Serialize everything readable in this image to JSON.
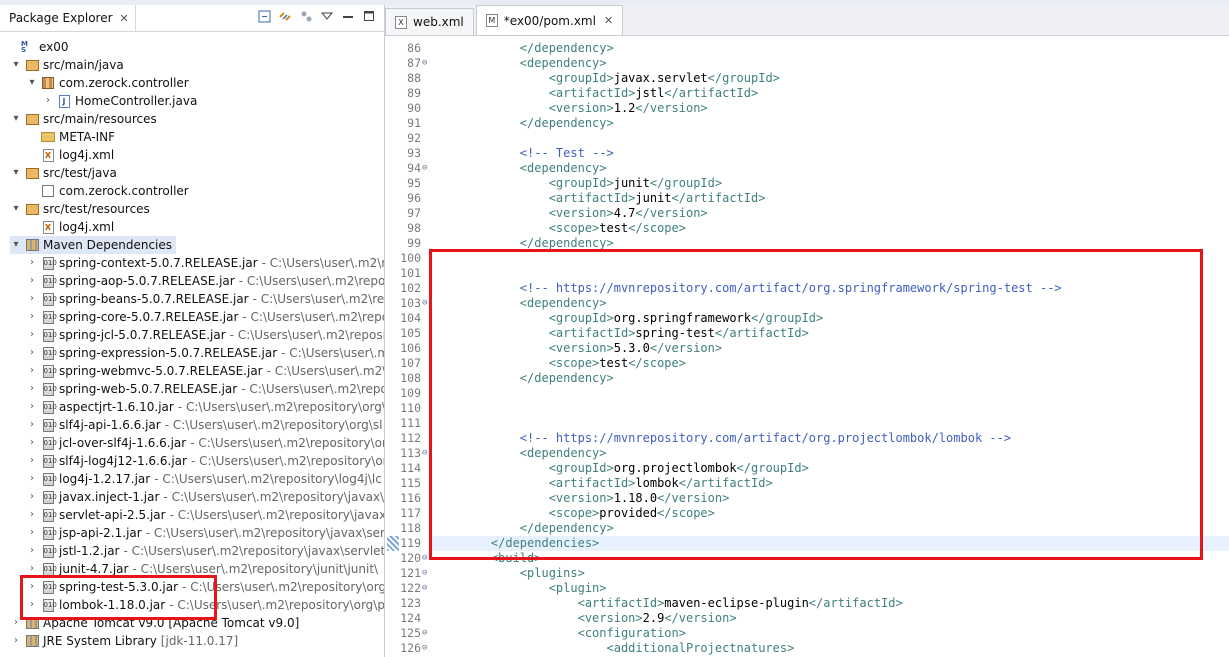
{
  "left_panel": {
    "title": "Package Explorer",
    "close": "✕",
    "tree": [
      {
        "label": "ex00",
        "path": "",
        "icon": "project-icon",
        "twisty": "",
        "indent": 0
      },
      {
        "label": "src/main/java",
        "path": "",
        "icon": "package-folder-icon",
        "twisty": "▾",
        "indent": 1
      },
      {
        "label": "com.zerock.controller",
        "path": "",
        "icon": "package-icon",
        "twisty": "▾",
        "indent": 2
      },
      {
        "label": "HomeController.java",
        "path": "",
        "icon": "java-file-icon",
        "twisty": "›",
        "indent": 3
      },
      {
        "label": "src/main/resources",
        "path": "",
        "icon": "package-folder-icon",
        "twisty": "▾",
        "indent": 1
      },
      {
        "label": "META-INF",
        "path": "",
        "icon": "folder-icon",
        "twisty": "",
        "indent": 2
      },
      {
        "label": "log4j.xml",
        "path": "",
        "icon": "xml-file-icon",
        "twisty": "",
        "indent": 2
      },
      {
        "label": "src/test/java",
        "path": "",
        "icon": "package-folder-icon",
        "twisty": "▾",
        "indent": 1
      },
      {
        "label": "com.zerock.controller",
        "path": "",
        "icon": "empty-package-icon",
        "twisty": "",
        "indent": 2
      },
      {
        "label": "src/test/resources",
        "path": "",
        "icon": "package-folder-icon",
        "twisty": "▾",
        "indent": 1
      },
      {
        "label": "log4j.xml",
        "path": "",
        "icon": "xml-file-icon",
        "twisty": "",
        "indent": 2
      },
      {
        "label": "Maven Dependencies",
        "path": "",
        "icon": "library-icon",
        "twisty": "▾",
        "indent": 1,
        "selected": true
      },
      {
        "label": "spring-context-5.0.7.RELEASE.jar",
        "path": "- C:\\Users\\user\\.m2\\rep",
        "icon": "jar-icon",
        "twisty": "›",
        "indent": 2
      },
      {
        "label": "spring-aop-5.0.7.RELEASE.jar",
        "path": "- C:\\Users\\user\\.m2\\repositor",
        "icon": "jar-icon",
        "twisty": "›",
        "indent": 2
      },
      {
        "label": "spring-beans-5.0.7.RELEASE.jar",
        "path": "- C:\\Users\\user\\.m2\\repo",
        "icon": "jar-icon",
        "twisty": "›",
        "indent": 2
      },
      {
        "label": "spring-core-5.0.7.RELEASE.jar",
        "path": "- C:\\Users\\user\\.m2\\reposi",
        "icon": "jar-icon",
        "twisty": "›",
        "indent": 2
      },
      {
        "label": "spring-jcl-5.0.7.RELEASE.jar",
        "path": "- C:\\Users\\user\\.m2\\reposito",
        "icon": "jar-icon",
        "twisty": "›",
        "indent": 2
      },
      {
        "label": "spring-expression-5.0.7.RELEASE.jar",
        "path": "- C:\\Users\\user\\.m2\\",
        "icon": "jar-icon",
        "twisty": "›",
        "indent": 2
      },
      {
        "label": "spring-webmvc-5.0.7.RELEASE.jar",
        "path": "- C:\\Users\\user\\.m2\\re",
        "icon": "jar-icon",
        "twisty": "›",
        "indent": 2
      },
      {
        "label": "spring-web-5.0.7.RELEASE.jar",
        "path": "- C:\\Users\\user\\.m2\\repos",
        "icon": "jar-icon",
        "twisty": "›",
        "indent": 2
      },
      {
        "label": "aspectjrt-1.6.10.jar",
        "path": "- C:\\Users\\user\\.m2\\repository\\org\\",
        "icon": "jar-icon",
        "twisty": "›",
        "indent": 2
      },
      {
        "label": "slf4j-api-1.6.6.jar",
        "path": "- C:\\Users\\user\\.m2\\repository\\org\\sl",
        "icon": "jar-icon",
        "twisty": "›",
        "indent": 2
      },
      {
        "label": "jcl-over-slf4j-1.6.6.jar",
        "path": "- C:\\Users\\user\\.m2\\repository\\or",
        "icon": "jar-icon",
        "twisty": "›",
        "indent": 2
      },
      {
        "label": "slf4j-log4j12-1.6.6.jar",
        "path": "- C:\\Users\\user\\.m2\\repository\\or",
        "icon": "jar-icon",
        "twisty": "›",
        "indent": 2
      },
      {
        "label": "log4j-1.2.17.jar",
        "path": "- C:\\Users\\user\\.m2\\repository\\log4j\\lc",
        "icon": "jar-icon",
        "twisty": "›",
        "indent": 2
      },
      {
        "label": "javax.inject-1.jar",
        "path": "- C:\\Users\\user\\.m2\\repository\\javax\\i",
        "icon": "jar-icon",
        "twisty": "›",
        "indent": 2
      },
      {
        "label": "servlet-api-2.5.jar",
        "path": "- C:\\Users\\user\\.m2\\repository\\javax\\",
        "icon": "jar-icon",
        "twisty": "›",
        "indent": 2
      },
      {
        "label": "jsp-api-2.1.jar",
        "path": "- C:\\Users\\user\\.m2\\repository\\javax\\ser",
        "icon": "jar-icon",
        "twisty": "›",
        "indent": 2
      },
      {
        "label": "jstl-1.2.jar",
        "path": "- C:\\Users\\user\\.m2\\repository\\javax\\servlet\\",
        "icon": "jar-icon",
        "twisty": "›",
        "indent": 2
      },
      {
        "label": "junit-4.7.jar",
        "path": "- C:\\Users\\user\\.m2\\repository\\junit\\junit\\",
        "icon": "jar-icon",
        "twisty": "›",
        "indent": 2
      },
      {
        "label": "spring-test-5.3.0.jar",
        "path": "- C:\\Users\\user\\.m2\\repository\\org\\",
        "icon": "jar-icon",
        "twisty": "›",
        "indent": 2
      },
      {
        "label": "lombok-1.18.0.jar",
        "path": "- C:\\Users\\user\\.m2\\repository\\org\\p",
        "icon": "jar-icon",
        "twisty": "›",
        "indent": 2
      },
      {
        "label": "Apache Tomcat v9.0 [Apache Tomcat v9.0]",
        "path": "",
        "icon": "library-icon",
        "twisty": "›",
        "indent": 1
      },
      {
        "label": "JRE System Library",
        "path": "[jdk-11.0.17]",
        "icon": "library-icon",
        "twisty": "›",
        "indent": 1
      }
    ]
  },
  "editor": {
    "tabs": [
      {
        "label": "web.xml",
        "icon": "X",
        "active": false,
        "close": ""
      },
      {
        "label": "*ex00/pom.xml",
        "icon": "M",
        "active": true,
        "close": "✕"
      }
    ],
    "lines": [
      {
        "n": "86",
        "fold": "",
        "t": [
          [
            "tg",
            "        </dependency>"
          ]
        ]
      },
      {
        "n": "87",
        "fold": "⊖",
        "t": [
          [
            "tg",
            "        <dependency>"
          ]
        ]
      },
      {
        "n": "88",
        "fold": "",
        "t": [
          [
            "tg",
            "            <groupId>"
          ],
          [
            "tx",
            "javax.servlet"
          ],
          [
            "tg",
            "</groupId>"
          ]
        ]
      },
      {
        "n": "89",
        "fold": "",
        "t": [
          [
            "tg",
            "            <artifactId>"
          ],
          [
            "tx",
            "jstl"
          ],
          [
            "tg",
            "</artifactId>"
          ]
        ]
      },
      {
        "n": "90",
        "fold": "",
        "t": [
          [
            "tg",
            "            <version>"
          ],
          [
            "tx",
            "1.2"
          ],
          [
            "tg",
            "</version>"
          ]
        ]
      },
      {
        "n": "91",
        "fold": "",
        "t": [
          [
            "tg",
            "        </dependency>"
          ]
        ]
      },
      {
        "n": "92",
        "fold": "",
        "t": []
      },
      {
        "n": "93",
        "fold": "",
        "t": [
          [
            "cm",
            "        <!-- Test -->"
          ]
        ]
      },
      {
        "n": "94",
        "fold": "⊖",
        "t": [
          [
            "tg",
            "        <dependency>"
          ]
        ]
      },
      {
        "n": "95",
        "fold": "",
        "t": [
          [
            "tg",
            "            <groupId>"
          ],
          [
            "tx",
            "junit"
          ],
          [
            "tg",
            "</groupId>"
          ]
        ]
      },
      {
        "n": "96",
        "fold": "",
        "t": [
          [
            "tg",
            "            <artifactId>"
          ],
          [
            "tx",
            "junit"
          ],
          [
            "tg",
            "</artifactId>"
          ]
        ]
      },
      {
        "n": "97",
        "fold": "",
        "t": [
          [
            "tg",
            "            <version>"
          ],
          [
            "tx",
            "4.7"
          ],
          [
            "tg",
            "</version>"
          ]
        ]
      },
      {
        "n": "98",
        "fold": "",
        "t": [
          [
            "tg",
            "            <scope>"
          ],
          [
            "tx",
            "test"
          ],
          [
            "tg",
            "</scope>"
          ]
        ]
      },
      {
        "n": "99",
        "fold": "",
        "t": [
          [
            "tg",
            "        </dependency>"
          ]
        ]
      },
      {
        "n": "100",
        "fold": "",
        "t": []
      },
      {
        "n": "101",
        "fold": "",
        "t": []
      },
      {
        "n": "102",
        "fold": "",
        "t": [
          [
            "cm",
            "        <!-- https://mvnrepository.com/artifact/org.springframework/spring-test -->"
          ]
        ]
      },
      {
        "n": "103",
        "fold": "⊖",
        "t": [
          [
            "tg",
            "        <dependency>"
          ]
        ]
      },
      {
        "n": "104",
        "fold": "",
        "t": [
          [
            "tg",
            "            <groupId>"
          ],
          [
            "tx",
            "org.springframework"
          ],
          [
            "tg",
            "</groupId>"
          ]
        ]
      },
      {
        "n": "105",
        "fold": "",
        "t": [
          [
            "tg",
            "            <artifactId>"
          ],
          [
            "tx",
            "spring-test"
          ],
          [
            "tg",
            "</artifactId>"
          ]
        ]
      },
      {
        "n": "106",
        "fold": "",
        "t": [
          [
            "tg",
            "            <version>"
          ],
          [
            "tx",
            "5.3.0"
          ],
          [
            "tg",
            "</version>"
          ]
        ]
      },
      {
        "n": "107",
        "fold": "",
        "t": [
          [
            "tg",
            "            <scope>"
          ],
          [
            "tx",
            "test"
          ],
          [
            "tg",
            "</scope>"
          ]
        ]
      },
      {
        "n": "108",
        "fold": "",
        "t": [
          [
            "tg",
            "        </dependency>"
          ]
        ]
      },
      {
        "n": "109",
        "fold": "",
        "t": []
      },
      {
        "n": "110",
        "fold": "",
        "t": []
      },
      {
        "n": "111",
        "fold": "",
        "t": []
      },
      {
        "n": "112",
        "fold": "",
        "t": [
          [
            "cm",
            "        <!-- https://mvnrepository.com/artifact/org.projectlombok/lombok -->"
          ]
        ]
      },
      {
        "n": "113",
        "fold": "⊖",
        "t": [
          [
            "tg",
            "        <dependency>"
          ]
        ]
      },
      {
        "n": "114",
        "fold": "",
        "t": [
          [
            "tg",
            "            <groupId>"
          ],
          [
            "tx",
            "org.projectlombok"
          ],
          [
            "tg",
            "</groupId>"
          ]
        ]
      },
      {
        "n": "115",
        "fold": "",
        "t": [
          [
            "tg",
            "            <artifactId>"
          ],
          [
            "tx",
            "lombok"
          ],
          [
            "tg",
            "</artifactId>"
          ]
        ]
      },
      {
        "n": "116",
        "fold": "",
        "t": [
          [
            "tg",
            "            <version>"
          ],
          [
            "tx",
            "1.18.0"
          ],
          [
            "tg",
            "</version>"
          ]
        ]
      },
      {
        "n": "117",
        "fold": "",
        "t": [
          [
            "tg",
            "            <scope>"
          ],
          [
            "tx",
            "provided"
          ],
          [
            "tg",
            "</scope>"
          ]
        ]
      },
      {
        "n": "118",
        "fold": "",
        "t": [
          [
            "tg",
            "        </dependency>"
          ]
        ]
      },
      {
        "n": "119",
        "fold": "",
        "t": [
          [
            "tg",
            "    </dependencies>"
          ]
        ],
        "highlight": true
      },
      {
        "n": "120",
        "fold": "⊖",
        "t": [
          [
            "tg",
            "    <build>"
          ]
        ]
      },
      {
        "n": "121",
        "fold": "⊖",
        "t": [
          [
            "tg",
            "        <plugins>"
          ]
        ]
      },
      {
        "n": "122",
        "fold": "⊖",
        "t": [
          [
            "tg",
            "            <plugin>"
          ]
        ]
      },
      {
        "n": "123",
        "fold": "",
        "t": [
          [
            "tg",
            "                <artifactId>"
          ],
          [
            "tx",
            "maven-eclipse-plugin"
          ],
          [
            "tg",
            "</artifactId>"
          ]
        ]
      },
      {
        "n": "124",
        "fold": "",
        "t": [
          [
            "tg",
            "                <version>"
          ],
          [
            "tx",
            "2.9"
          ],
          [
            "tg",
            "</version>"
          ]
        ]
      },
      {
        "n": "125",
        "fold": "⊖",
        "t": [
          [
            "tg",
            "                <configuration>"
          ]
        ]
      },
      {
        "n": "126",
        "fold": "⊖",
        "t": [
          [
            "tg",
            "                    <additionalProjectnatures>"
          ]
        ]
      }
    ]
  }
}
